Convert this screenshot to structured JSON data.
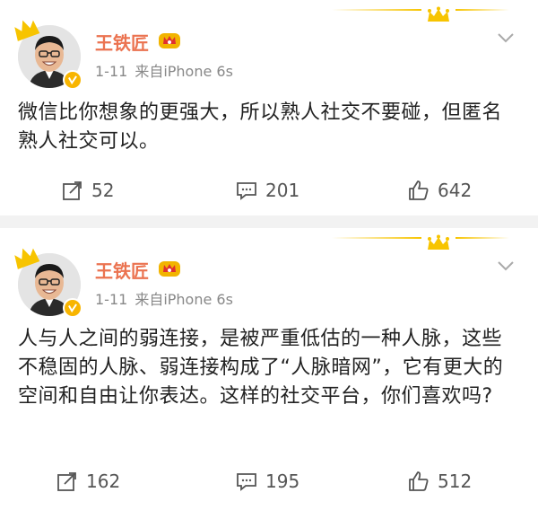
{
  "posts": [
    {
      "author": "王铁匠",
      "time": "1-11",
      "source": "来自iPhone 6s",
      "text": "微信比你想象的更强大，所以熟人社交不要碰，但匿名熟人社交可以。",
      "repost_count": "52",
      "comment_count": "201",
      "like_count": "642"
    },
    {
      "author": "王铁匠",
      "time": "1-11",
      "source": "来自iPhone 6s",
      "text": "人与人之间的弱连接，是被严重低估的一种人脉，这些不稳固的人脉、弱连接构成了“人脉暗网”，它有更大的空间和自由让你表达。这样的社交平台，你们喜欢吗?",
      "repost_count": "162",
      "comment_count": "195",
      "like_count": "512"
    }
  ],
  "icons": {
    "repost": "repost-icon",
    "comment": "comment-icon",
    "like": "thumbs-up-icon",
    "more": "chevron-down-icon",
    "verified": "verified-badge-icon",
    "vip": "vip-crown-icon"
  },
  "colors": {
    "username": "#eb7350",
    "gold": "#f7c400",
    "meta": "#888888"
  }
}
